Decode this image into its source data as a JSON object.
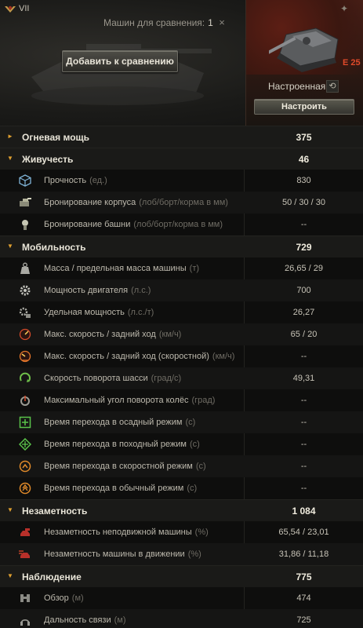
{
  "header": {
    "compare_label": "Машин для сравнения:",
    "compare_count": "1",
    "close_glyph": "×",
    "add_button": "Добавить к сравнению"
  },
  "tank": {
    "tier": "VII",
    "name": "E 25",
    "config_state": "Настроенная",
    "configure_button": "Настроить",
    "reset_glyph": "⟲"
  },
  "colors": {
    "accent": "#e0a030",
    "tank_name": "#e04a2a"
  },
  "rows": [
    {
      "kind": "section",
      "label": "Огневая мощь",
      "value": "375",
      "expanded": false
    },
    {
      "kind": "section",
      "label": "Живучесть",
      "value": "46",
      "expanded": true
    },
    {
      "kind": "item",
      "icon": "durability-cube-icon",
      "label": "Прочность",
      "unit": "(ед.)",
      "value": "830"
    },
    {
      "kind": "item",
      "icon": "hull-armor-icon",
      "label": "Бронирование корпуса",
      "unit": "(лоб/борт/корма в мм)",
      "value": "50 / 30 / 30"
    },
    {
      "kind": "item",
      "icon": "turret-armor-icon",
      "label": "Бронирование башни",
      "unit": "(лоб/борт/корма в мм)",
      "value": "--"
    },
    {
      "kind": "section",
      "label": "Мобильность",
      "value": "729",
      "expanded": true
    },
    {
      "kind": "item",
      "icon": "weight-icon",
      "label": "Масса / предельная масса машины",
      "unit": "(т)",
      "value": "26,65 / 29"
    },
    {
      "kind": "item",
      "icon": "engine-gear-icon",
      "label": "Мощность двигателя",
      "unit": "(л.с.)",
      "value": "700"
    },
    {
      "kind": "item",
      "icon": "specific-power-icon",
      "label": "Удельная мощность",
      "unit": "(л.с./т)",
      "value": "26,27"
    },
    {
      "kind": "item",
      "icon": "speedometer-icon",
      "label": "Макс. скорость / задний ход",
      "unit": "(км/ч)",
      "value": "65 / 20"
    },
    {
      "kind": "item",
      "icon": "speedometer-fast-icon",
      "label": "Макс. скорость / задний ход (скоростной)",
      "unit": "(км/ч)",
      "value": "--"
    },
    {
      "kind": "item",
      "icon": "traverse-icon",
      "label": "Скорость поворота шасси",
      "unit": "(град/с)",
      "value": "49,31"
    },
    {
      "kind": "item",
      "icon": "wheel-angle-icon",
      "label": "Максимальный угол поворота колёс",
      "unit": "(град)",
      "value": "--"
    },
    {
      "kind": "item",
      "icon": "siege-mode-icon",
      "label": "Время перехода в осадный режим",
      "unit": "(с)",
      "value": "--"
    },
    {
      "kind": "item",
      "icon": "travel-mode-icon",
      "label": "Время перехода в походный режим",
      "unit": "(с)",
      "value": "--"
    },
    {
      "kind": "item",
      "icon": "speed-mode-icon",
      "label": "Время перехода в скоростной режим",
      "unit": "(с)",
      "value": "--"
    },
    {
      "kind": "item",
      "icon": "normal-mode-icon",
      "label": "Время перехода в обычный режим",
      "unit": "(с)",
      "value": "--"
    },
    {
      "kind": "section",
      "label": "Незаметность",
      "value": "1 084",
      "expanded": true
    },
    {
      "kind": "item",
      "icon": "camo-stationary-icon",
      "label": "Незаметность неподвижной машины",
      "unit": "(%)",
      "value": "65,54 / 23,01"
    },
    {
      "kind": "item",
      "icon": "camo-moving-icon",
      "label": "Незаметность машины в движении",
      "unit": "(%)",
      "value": "31,86 / 11,18"
    },
    {
      "kind": "section",
      "label": "Наблюдение",
      "value": "775",
      "expanded": true
    },
    {
      "kind": "item",
      "icon": "view-range-icon",
      "label": "Обзор",
      "unit": "(м)",
      "value": "474"
    },
    {
      "kind": "item",
      "icon": "radio-range-icon",
      "label": "Дальность связи",
      "unit": "(м)",
      "value": "725"
    }
  ]
}
